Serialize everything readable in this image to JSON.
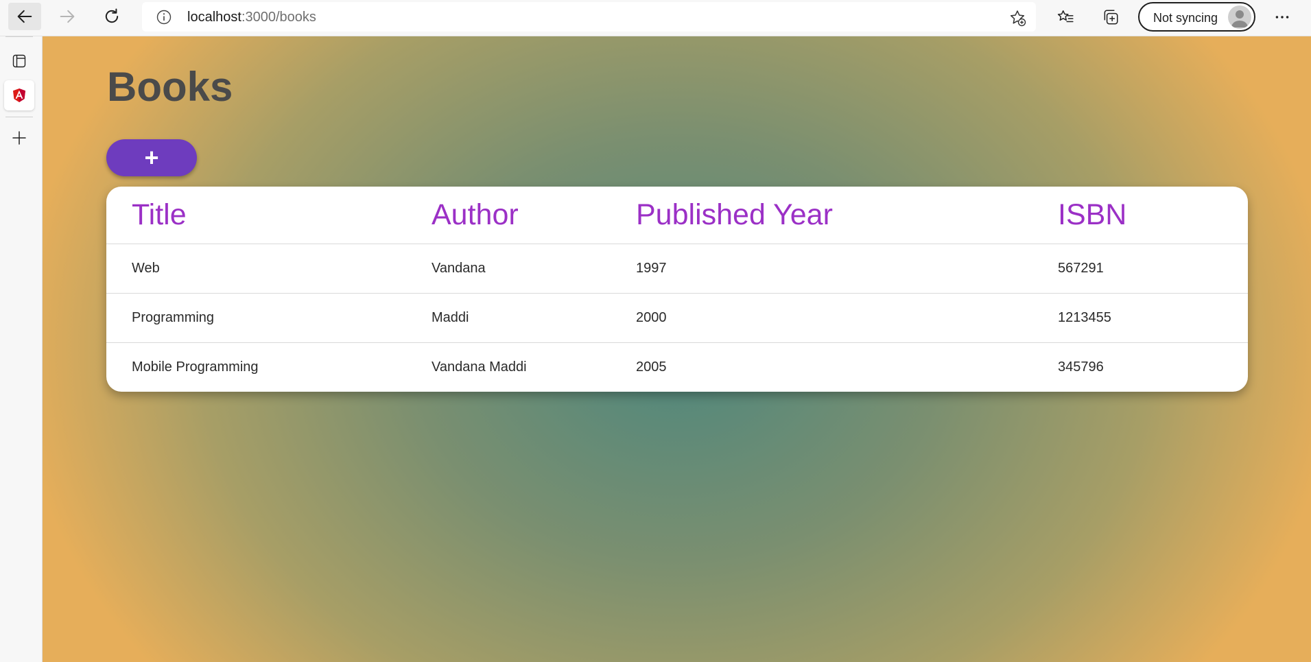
{
  "browser": {
    "url_host": "localhost",
    "url_path": ":3000/books",
    "sync_label": "Not syncing"
  },
  "page": {
    "title": "Books",
    "add_button_label": "+"
  },
  "table": {
    "headers": [
      "Title",
      "Author",
      "Published Year",
      "ISBN"
    ],
    "rows": [
      [
        "Web",
        "Vandana",
        "1997",
        "567291"
      ],
      [
        "Programming",
        "Maddi",
        "2000",
        "1213455"
      ],
      [
        "Mobile Programming",
        "Vandana Maddi",
        "2005",
        "345796"
      ]
    ]
  },
  "colors": {
    "accent_purple": "#6e3cbe",
    "header_text": "#9b30c6",
    "title_text": "#4a4a4a",
    "bg_center": "#4e877d",
    "bg_edge": "#e6ae5a"
  },
  "icons": {
    "back": "back-arrow-icon",
    "forward": "forward-arrow-icon",
    "reload": "reload-icon",
    "info": "info-icon",
    "add_favorite": "star-plus-icon",
    "favorites": "favorites-icon",
    "collections": "collections-icon",
    "profile": "avatar",
    "menu": "more-icon",
    "tabs": "tab-actions-icon",
    "angular": "angular-icon",
    "new_tab": "plus-icon"
  }
}
